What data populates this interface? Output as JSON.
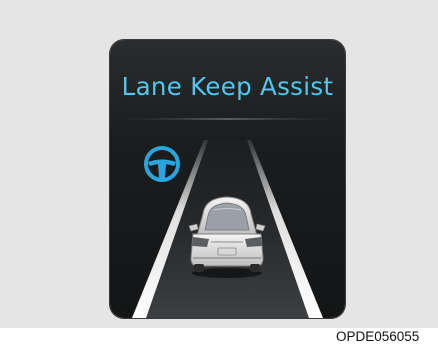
{
  "display": {
    "title": "Lane Keep Assist",
    "status_icon": "steering-wheel-icon",
    "vehicle_icon": "car-rear-view-icon",
    "colors": {
      "title": "#4ec8f0",
      "icon": "#2aa6df",
      "background": "#1b1d1f",
      "lane_lines": "#ffffff"
    }
  },
  "caption": {
    "code": "OPDE056055"
  }
}
